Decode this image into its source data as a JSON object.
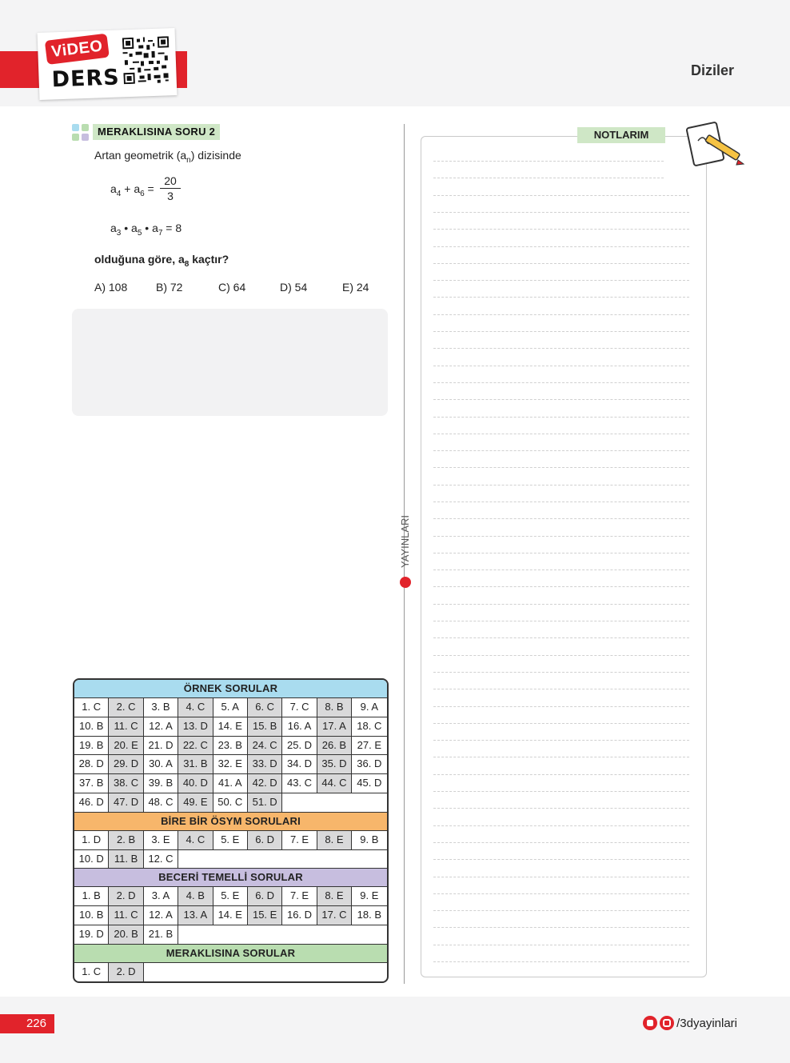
{
  "header": {
    "video_label": "ViDEO",
    "ders_label": "DERS",
    "chapter_title": "Diziler"
  },
  "question": {
    "label": "MERAKLISINA SORU 2",
    "intro": "Artan geometrik (a",
    "intro_sub": "n",
    "intro_tail": ") dizisinde",
    "eq1_lhs": [
      "a",
      "4",
      " + a",
      "6",
      " ="
    ],
    "eq1_num": "20",
    "eq1_den": "3",
    "eq2": [
      "a",
      "3",
      " • a",
      "5",
      " • a",
      "7",
      " = 8"
    ],
    "prompt": "olduğuna göre, a",
    "prompt_sub": "8",
    "prompt_tail": " kaçtır?",
    "options": [
      "A) 108",
      "B) 72",
      "C) 64",
      "D) 54",
      "E) 24"
    ]
  },
  "answer_key": {
    "sections": [
      {
        "title": "ÖRNEK SORULAR",
        "color": "#a9dcef",
        "rows": [
          [
            "1. C",
            "2. C",
            "3. B",
            "4. C",
            "5. A",
            "6. C",
            "7. C",
            "8. B",
            "9. A"
          ],
          [
            "10. B",
            "11. C",
            "12. A",
            "13. D",
            "14. E",
            "15. B",
            "16. A",
            "17. A",
            "18. C"
          ],
          [
            "19. B",
            "20. E",
            "21. D",
            "22. C",
            "23. B",
            "24. C",
            "25. D",
            "26. B",
            "27. E"
          ],
          [
            "28. D",
            "29. D",
            "30. A",
            "31. B",
            "32. E",
            "33. D",
            "34. D",
            "35. D",
            "36. D"
          ],
          [
            "37. B",
            "38. C",
            "39. B",
            "40. D",
            "41. A",
            "42. D",
            "43. C",
            "44. C",
            "45. D"
          ],
          [
            "46. D",
            "47. D",
            "48. C",
            "49. E",
            "50. C",
            "51. D"
          ]
        ]
      },
      {
        "title": "BİRE BİR ÖSYM SORULARI",
        "color": "#f7b66b",
        "rows": [
          [
            "1. D",
            "2. B",
            "3. E",
            "4. C",
            "5. E",
            "6. D",
            "7. E",
            "8. E",
            "9. B"
          ],
          [
            "10. D",
            "11. B",
            "12. C"
          ]
        ]
      },
      {
        "title": "BECERİ TEMELLİ SORULAR",
        "color": "#c7bedf",
        "rows": [
          [
            "1. B",
            "2. D",
            "3. A",
            "4. B",
            "5. E",
            "6. D",
            "7. E",
            "8. E",
            "9. E"
          ],
          [
            "10. B",
            "11. C",
            "12. A",
            "13. A",
            "14. E",
            "15. E",
            "16. D",
            "17. C",
            "18. B"
          ],
          [
            "19. D",
            "20. B",
            "21. B"
          ]
        ]
      },
      {
        "title": "MERAKLISINA SORULAR",
        "color": "#b9ddb0",
        "rows": [
          [
            "1. C",
            "2. D"
          ]
        ]
      }
    ]
  },
  "sidebar_publisher": "YAYINLARI",
  "notes": {
    "title": "NOTLARIM"
  },
  "footer": {
    "page_number": "226",
    "social_handle": "/3dyayinlari"
  },
  "colors": {
    "brand_red": "#e1232b",
    "green_tab": "#cfe7c6",
    "alt_cell": "#d9d9da"
  }
}
